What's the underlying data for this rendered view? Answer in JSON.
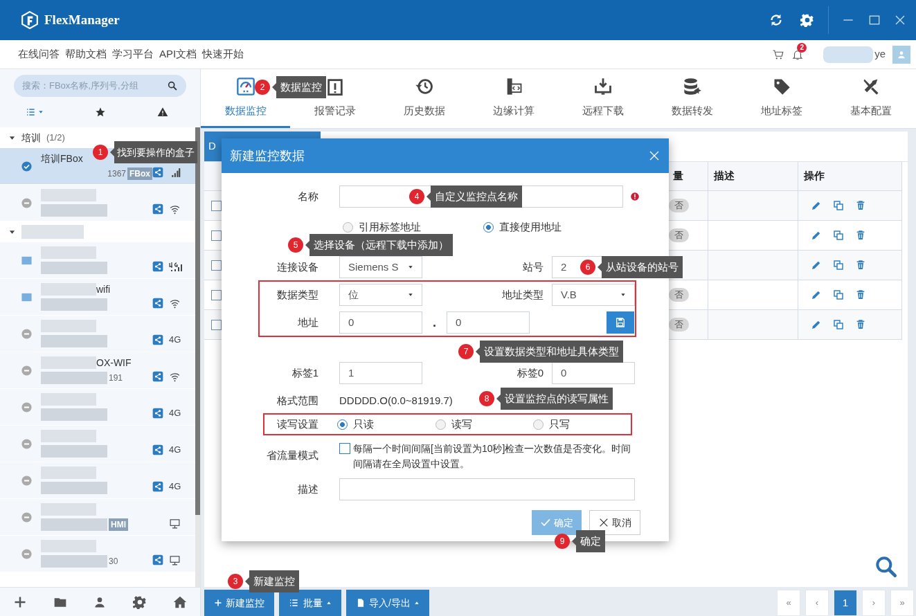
{
  "window": {
    "title": "FlexManager"
  },
  "top_links": [
    "在线问答",
    "帮助文档",
    "学习平台",
    "API文档",
    "快速开始"
  ],
  "user": {
    "notification_count": "2",
    "name": "ye"
  },
  "sidebar": {
    "search": {
      "placeholder": "搜索：FBox名称,序列号,分组"
    },
    "groups": [
      {
        "name": "培训",
        "count": "(1/2)",
        "expanded": true,
        "redacted": false,
        "items": [
          {
            "kind": "online",
            "selected": true,
            "redacted": false,
            "name": "培训FBox",
            "serial": "1367",
            "tag": "FBox",
            "shared": true,
            "signal": true
          },
          {
            "kind": "offline",
            "selected": false,
            "redacted": true,
            "shared": true,
            "wifi": true
          }
        ]
      },
      {
        "expanded": true,
        "redacted": true,
        "items": [
          {
            "kind": "pending",
            "selected": false,
            "redacted": true,
            "shared": true,
            "signal_4g": true
          },
          {
            "kind": "pending",
            "selected": false,
            "redacted": true,
            "name": "wifi",
            "shared": true,
            "wifi": true
          },
          {
            "kind": "offline",
            "selected": false,
            "redacted": true,
            "shared": true,
            "network_label": "4G"
          },
          {
            "kind": "offline",
            "selected": false,
            "redacted": true,
            "name": "OX-WIF",
            "serial": "191",
            "shared": true,
            "wifi": true
          },
          {
            "kind": "offline",
            "selected": false,
            "redacted": true,
            "shared": true,
            "network_label": "4G"
          },
          {
            "kind": "offline",
            "selected": false,
            "redacted": true,
            "shared": true,
            "network_label": "4G"
          },
          {
            "kind": "offline",
            "selected": false,
            "redacted": true,
            "shared": true,
            "network_label": "4G"
          },
          {
            "kind": "offline",
            "selected": false,
            "redacted": true,
            "tag": "HMI",
            "shared": false,
            "lan": true
          },
          {
            "kind": "offline",
            "selected": false,
            "redacted": true,
            "serial": "30",
            "shared": true,
            "lan": true
          }
        ]
      }
    ]
  },
  "nav_tabs": [
    {
      "label": "数据监控",
      "selected": true
    },
    {
      "label": "报警记录",
      "selected": false
    },
    {
      "label": "历史数据",
      "selected": false
    },
    {
      "label": "边缘计算",
      "selected": false
    },
    {
      "label": "远程下载",
      "selected": false
    },
    {
      "label": "数据转发",
      "selected": false
    },
    {
      "label": "地址标签",
      "selected": false
    },
    {
      "label": "基本配置",
      "selected": false
    }
  ],
  "content_tab": {
    "label": "D"
  },
  "table": {
    "columns": [
      "量",
      "描述",
      "操作"
    ],
    "rows": [
      {
        "checked": false,
        "value": "否"
      },
      {
        "checked": false,
        "value": "否"
      },
      {
        "checked": false
      },
      {
        "checked": false,
        "value": "否"
      },
      {
        "checked": false,
        "value": "否"
      }
    ]
  },
  "toolbar_buttons": [
    {
      "label": "新建监控",
      "kind": "add"
    },
    {
      "label": "批量",
      "kind": "batch"
    },
    {
      "label": "导入/导出",
      "kind": "file"
    }
  ],
  "pagination": [
    {
      "label": "«",
      "selected": false
    },
    {
      "label": "‹",
      "selected": false
    },
    {
      "label": "1",
      "selected": true
    },
    {
      "label": "›",
      "selected": false
    },
    {
      "label": "»",
      "selected": false
    }
  ],
  "dialog": {
    "title": "新建监控数据",
    "name_field": {
      "label": "名称",
      "required": true
    },
    "address_source": [
      {
        "label": "引用标签地址",
        "selected": false
      },
      {
        "label": "直接使用地址",
        "selected": true
      }
    ],
    "device": {
      "label": "连接设备",
      "value": "Siemens S"
    },
    "station": {
      "label": "站号",
      "value": "2"
    },
    "data_type": {
      "label": "数据类型",
      "value": "位"
    },
    "address_type": {
      "label": "地址类型",
      "value": "V.B"
    },
    "address": {
      "label": "地址",
      "byte": "0",
      "separator": ".",
      "bit": "0"
    },
    "tag1": {
      "label": "标签1",
      "value": "1"
    },
    "tag0": {
      "label": "标签0",
      "value": "0"
    },
    "format": {
      "label": "格式范围",
      "value": "DDDDD.O(0.0~81919.7)"
    },
    "access": {
      "label": "读写设置",
      "options": [
        {
          "label": "只读",
          "selected": true
        },
        {
          "label": "读写",
          "selected": false
        },
        {
          "label": "只写",
          "selected": false
        }
      ]
    },
    "save_mode": {
      "label": "省流量模式",
      "checked": false,
      "text": "每隔一个时间间隔[当前设置为10秒]检查一次数值是否变化。时间间隔请在全局设置中设置。"
    },
    "description": {
      "label": "描述"
    },
    "buttons": [
      {
        "label": "确定",
        "kind": "confirm"
      },
      {
        "label": "取消",
        "kind": "cancel"
      }
    ]
  },
  "annotations": [
    {
      "number": "1",
      "text": "找到要操作的盒子"
    },
    {
      "number": "2",
      "text": "数据监控"
    },
    {
      "number": "3",
      "text": "新建监控"
    },
    {
      "number": "4",
      "text": "自定义监控点名称"
    },
    {
      "number": "5",
      "text": "选择设备（远程下载中添加）"
    },
    {
      "number": "6",
      "text": "从站设备的站号"
    },
    {
      "number": "7",
      "text": "设置数据类型和地址具体类型"
    },
    {
      "number": "8",
      "text": "设置监控点的读写属性"
    },
    {
      "number": "9",
      "text": "确定"
    }
  ]
}
